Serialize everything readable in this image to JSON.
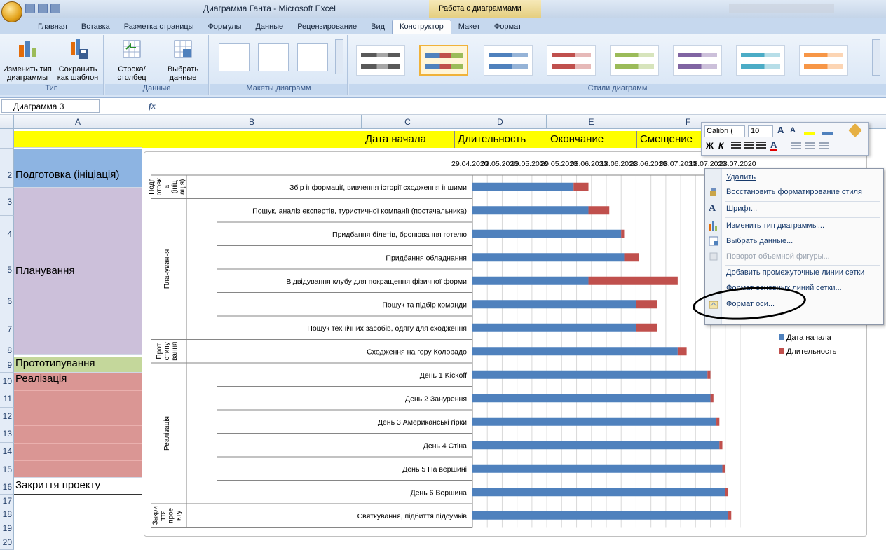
{
  "window": {
    "title": "Диаграмма Ганта - Microsoft Excel",
    "context_tab_group": "Работа с диаграммами"
  },
  "tabs": [
    "Главная",
    "Вставка",
    "Разметка страницы",
    "Формулы",
    "Данные",
    "Рецензирование",
    "Вид",
    "Конструктор",
    "Макет",
    "Формат"
  ],
  "active_tab": "Конструктор",
  "ribbon": {
    "type_group": {
      "label": "Тип",
      "change_type": "Изменить тип диаграммы",
      "save_template": "Сохранить как шаблон"
    },
    "data_group": {
      "label": "Данные",
      "switch": "Строка/столбец",
      "select": "Выбрать данные"
    },
    "layouts_group": {
      "label": "Макеты диаграмм"
    },
    "styles_group": {
      "label": "Стили диаграмм"
    }
  },
  "formula_bar": {
    "name_box": "Диаграмма 3",
    "fx": "fx"
  },
  "columns": [
    "A",
    "B",
    "C",
    "D",
    "E",
    "F"
  ],
  "row_numbers": [
    "",
    "",
    "2",
    "",
    "3",
    "",
    "4",
    "",
    "5",
    "",
    "6",
    "",
    "7",
    "",
    "8",
    "9",
    "10",
    "11",
    "12",
    "13",
    "14",
    "15",
    "16",
    "17",
    "18",
    "19",
    "20"
  ],
  "header_row": {
    "c": "Дата начала",
    "d": "Длительность",
    "e": "Окончание",
    "f": "Смещение"
  },
  "phases": [
    {
      "name": "Подготовка (ініціація)",
      "color": "#8db4e2"
    },
    {
      "name": "Планування",
      "color": "#ccc0da"
    },
    {
      "name": "Прототипування",
      "color": "#c4d79b"
    },
    {
      "name": "Реалізація",
      "color": "#da9694"
    },
    {
      "name": "Закриття проекту",
      "color": "#ffffff"
    }
  ],
  "colors": {
    "start": "#4f81bd",
    "duration": "#c0504d"
  },
  "chart_data": {
    "type": "bar",
    "orientation": "horizontal",
    "stacked": true,
    "x_tick_labels": [
      "29.04.2020",
      "09.05.2020",
      "19.05.2020",
      "29.05.2020",
      "08.06.2020",
      "18.06.2020",
      "28.06.2020",
      "08.07.2020",
      "18.07.2020",
      "28.07.2020"
    ],
    "x_axis_position": "top",
    "legend_position": "right",
    "groups": [
      {
        "label": "Подг отовк а (ініц ація)",
        "count": 1
      },
      {
        "label": "Планування",
        "count": 6
      },
      {
        "label": "Прот отипу вання",
        "count": 1
      },
      {
        "label": "Реалізація",
        "count": 6
      },
      {
        "label": "Закри ття прое кту",
        "count": 1
      }
    ],
    "categories": [
      "Збір інформації, вивчення історії сходження іншими",
      "Пошук, аналіз експертів, туристичної компанії (постачальника)",
      "Придбання білетів, бронювання готелю",
      "Придбання обладнання",
      "Відвідування клубу для покращення фізичної форми",
      "Пошук та підбір команди",
      "Пошук технічних засобів, одягу для сходження",
      "Сходження на гору Колорадо",
      "День 1 Kickoff",
      "День 2 Занурення",
      "День 3 Американські гірки",
      "День 4 Стіна",
      "День 5 На вершині",
      "День 6 Вершина",
      "Святкування, підбиття підсумків"
    ],
    "series": [
      {
        "name": "Дата начала",
        "values_days": [
          34,
          39,
          50,
          51,
          39,
          55,
          55,
          69,
          79,
          80,
          82,
          83,
          84,
          85,
          86
        ]
      },
      {
        "name": "Длительность",
        "values_days": [
          5,
          7,
          1,
          5,
          30,
          7,
          7,
          3,
          1,
          1,
          1,
          1,
          1,
          1,
          1
        ]
      }
    ]
  },
  "mini_toolbar": {
    "font": "Calibri (",
    "size": "10"
  },
  "context_menu": [
    {
      "label": "Удалить",
      "enabled": true
    },
    {
      "label": "Восстановить форматирование стиля",
      "enabled": true
    },
    {
      "label": "Шрифт...",
      "enabled": true
    },
    {
      "label": "Изменить тип диаграммы...",
      "enabled": true
    },
    {
      "label": "Выбрать данные...",
      "enabled": true
    },
    {
      "label": "Поворот объемной фигуры...",
      "enabled": false
    },
    {
      "label": "Добавить промежуточные линии сетки",
      "enabled": true
    },
    {
      "label": "Формат основных линий сетки...",
      "enabled": true
    },
    {
      "label": "Формат оси...",
      "enabled": true
    }
  ]
}
